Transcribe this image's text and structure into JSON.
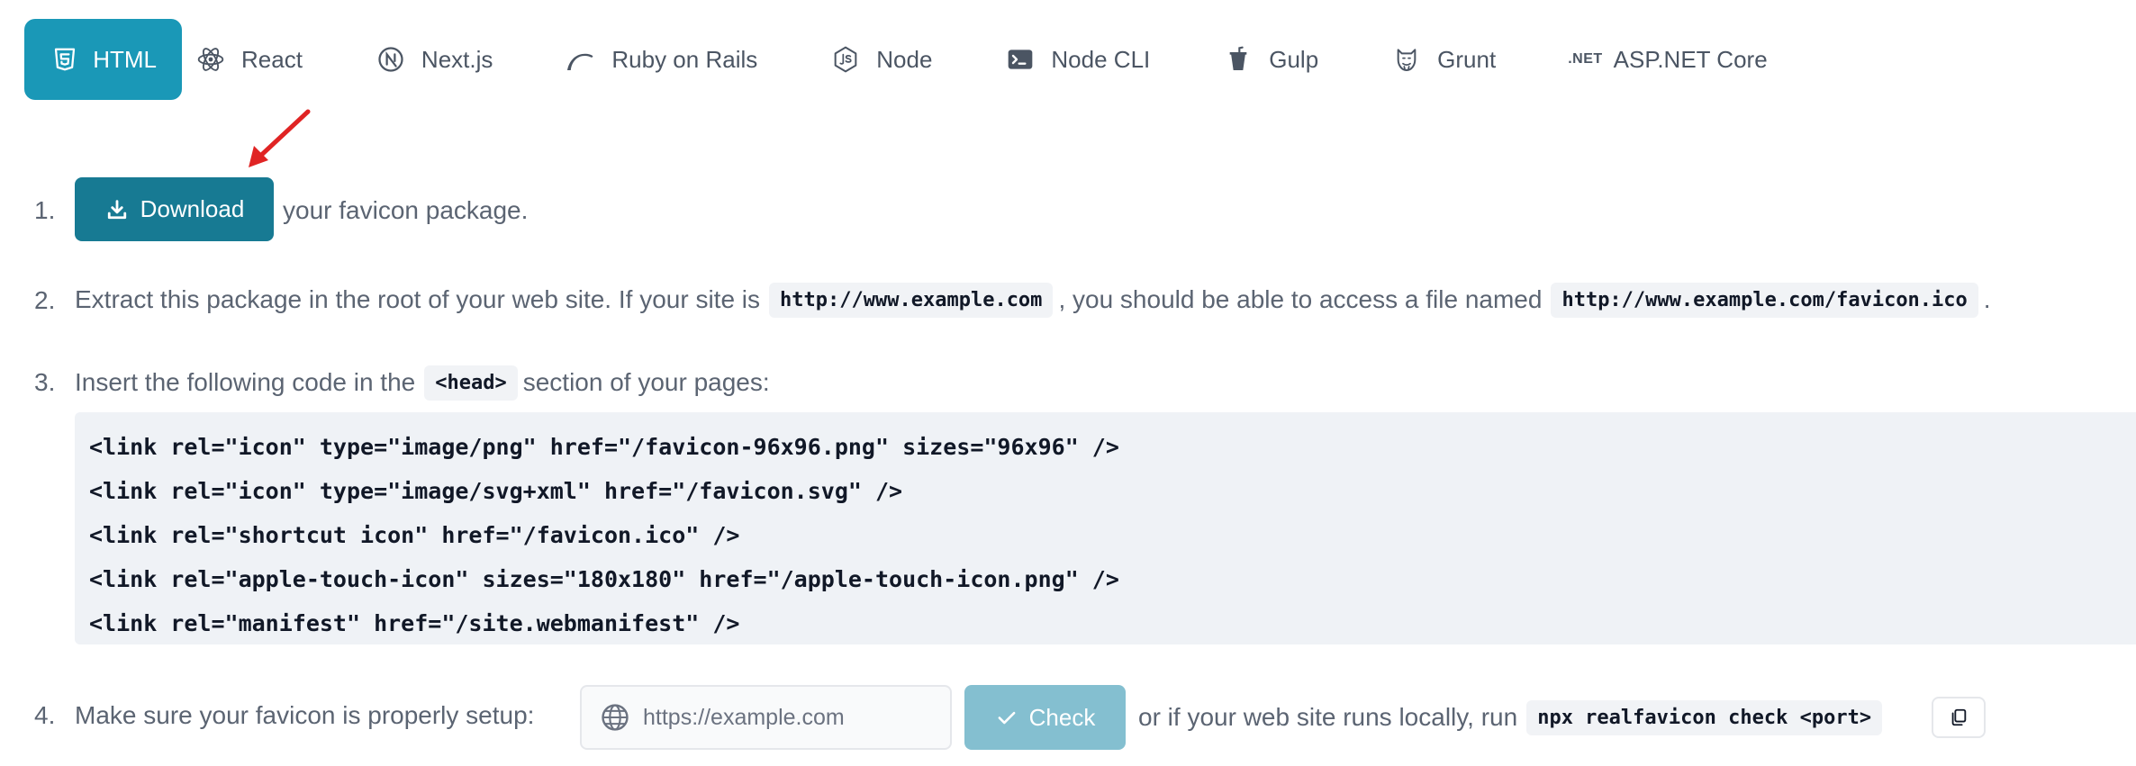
{
  "tabs": [
    {
      "label": "HTML",
      "icon": "html5-icon",
      "active": true
    },
    {
      "label": "React",
      "icon": "react-icon"
    },
    {
      "label": "Next.js",
      "icon": "nextjs-icon"
    },
    {
      "label": "Ruby on Rails",
      "icon": "rails-icon"
    },
    {
      "label": "Node",
      "icon": "nodejs-icon"
    },
    {
      "label": "Node CLI",
      "icon": "terminal-icon"
    },
    {
      "label": "Gulp",
      "icon": "gulp-icon"
    },
    {
      "label": "Grunt",
      "icon": "grunt-icon"
    },
    {
      "label": "ASP.NET Core",
      "icon": "dotnet-icon",
      "icon_text": ".NET"
    }
  ],
  "step1": {
    "number": "1.",
    "button_label": "Download",
    "text": "your favicon package."
  },
  "step2": {
    "number": "2.",
    "text_a": "Extract this package in the root of your web site. If your site is",
    "code_a": "http://www.example.com",
    "text_b": ", you should be able to access a file named",
    "code_b": "http://www.example.com/favicon.ico",
    "text_c": "."
  },
  "step3": {
    "number": "3.",
    "text_a": "Insert the following code in the",
    "code": "<head>",
    "text_b": "section of your pages:",
    "code_lines": [
      "<link rel=\"icon\" type=\"image/png\" href=\"/favicon-96x96.png\" sizes=\"96x96\" />",
      "<link rel=\"icon\" type=\"image/svg+xml\" href=\"/favicon.svg\" />",
      "<link rel=\"shortcut icon\" href=\"/favicon.ico\" />",
      "<link rel=\"apple-touch-icon\" sizes=\"180x180\" href=\"/apple-touch-icon.png\" />",
      "<link rel=\"manifest\" href=\"/site.webmanifest\" />"
    ]
  },
  "step4": {
    "number": "4.",
    "text_a": "Make sure your favicon is properly setup:",
    "input_placeholder": "https://example.com",
    "check_label": "Check",
    "text_b": "or if your web site runs locally, run",
    "code": "npx realfavicon check <port>"
  },
  "colors": {
    "active_tab": "#1a98b7",
    "download_button": "#177a93",
    "check_button": "#84bfd0",
    "arrow": "#e02424",
    "code_background": "#eff2f6"
  }
}
